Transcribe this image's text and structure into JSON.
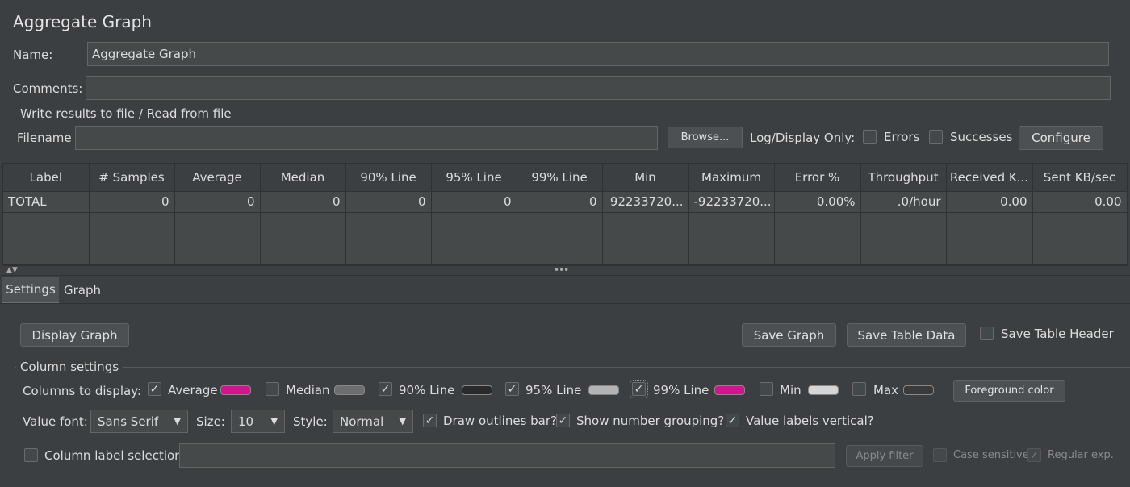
{
  "title": "Aggregate Graph",
  "name": {
    "label": "Name:",
    "value": "Aggregate Graph"
  },
  "comments": {
    "label": "Comments:",
    "value": ""
  },
  "file": {
    "group_title": "Write results to file / Read from file",
    "filename_label": "Filename",
    "filename_value": "",
    "browse": "Browse...",
    "log_display_only": "Log/Display Only:",
    "errors": "Errors",
    "successes": "Successes",
    "configure": "Configure"
  },
  "table": {
    "headers": [
      "Label",
      "# Samples",
      "Average",
      "Median",
      "90% Line",
      "95% Line",
      "99% Line",
      "Min",
      "Maximum",
      "Error %",
      "Throughput",
      "Received K...",
      "Sent KB/sec"
    ],
    "rows": [
      [
        "TOTAL",
        "0",
        "0",
        "0",
        "0",
        "0",
        "0",
        "92233720...",
        "-92233720...",
        "0.00%",
        ".0/hour",
        "0.00",
        "0.00"
      ]
    ]
  },
  "tabs": {
    "settings": "Settings",
    "graph": "Graph"
  },
  "settings": {
    "display_graph": "Display Graph",
    "save_graph": "Save Graph",
    "save_table_data": "Save Table Data",
    "save_table_header": "Save Table Header",
    "column_settings": "Column settings",
    "columns_to_display": "Columns to display:",
    "columns": [
      {
        "label": "Average",
        "checked": true,
        "color": "#d4138f"
      },
      {
        "label": "Median",
        "checked": false,
        "color": "#6e6e6e"
      },
      {
        "label": "90% Line",
        "checked": true,
        "color": "#2a2a2a"
      },
      {
        "label": "95% Line",
        "checked": true,
        "color": "#b4b4b4"
      },
      {
        "label": "99% Line",
        "checked": true,
        "color": "#d4138f"
      },
      {
        "label": "Min",
        "checked": false,
        "color": "#d6d6d6"
      },
      {
        "label": "Max",
        "checked": false,
        "color": "#3a3a3a"
      }
    ],
    "foreground_color": "Foreground color",
    "value_font_label": "Value font:",
    "value_font": "Sans Serif",
    "size_label": "Size:",
    "size": "10",
    "style_label": "Style:",
    "style": "Normal",
    "draw_outlines": "Draw outlines bar?",
    "show_number_grouping": "Show number grouping?",
    "value_labels_vertical": "Value labels vertical?",
    "column_label_selection": "Column label selection:",
    "column_label_value": "",
    "apply_filter": "Apply filter",
    "case_sensitive": "Case sensitive",
    "regular_exp": "Regular exp."
  }
}
